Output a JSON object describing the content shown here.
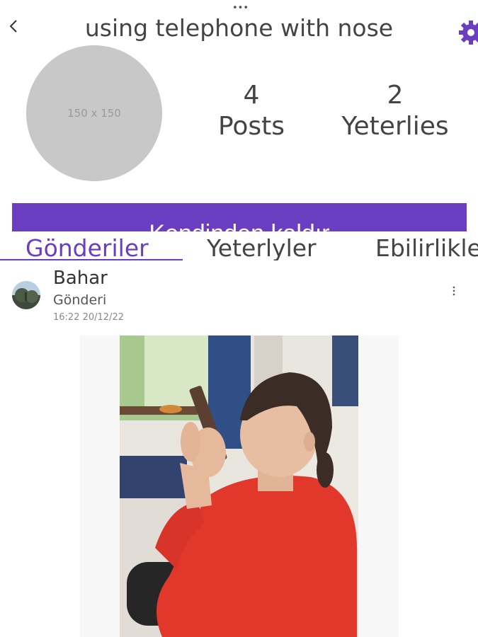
{
  "header": {
    "drag_handle": "•••",
    "back_icon": "back-chevron-icon",
    "title": "using telephone with nose",
    "settings_icon": "gear-icon",
    "accent_color": "#6b3dc0"
  },
  "profile": {
    "avatar_placeholder": "150 x 150",
    "stats": [
      {
        "count": "4",
        "label": "Posts"
      },
      {
        "count": "2",
        "label": "Yeterlies"
      }
    ],
    "action_button": "Kendinden kaldır"
  },
  "tabs": [
    {
      "label": "Gönderiler",
      "active": true
    },
    {
      "label": "Yeterlyler",
      "active": false
    },
    {
      "label": "Ebilirlikler",
      "active": false
    }
  ],
  "post": {
    "user": "Bahar",
    "type": "Gönderi",
    "timestamp": "16:22 20/12/22",
    "menu_icon": "more-vertical-icon"
  }
}
